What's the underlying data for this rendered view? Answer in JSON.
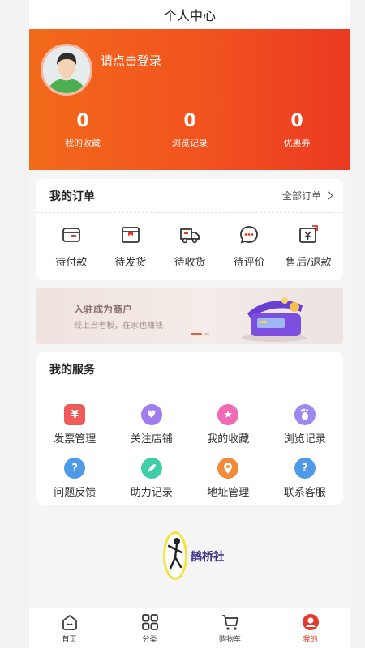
{
  "header": {
    "title": "个人中心"
  },
  "profile": {
    "login_prompt": "请点击登录",
    "stats": [
      {
        "value": "0",
        "label": "我的收藏"
      },
      {
        "value": "0",
        "label": "浏览记录"
      },
      {
        "value": "0",
        "label": "优惠券"
      }
    ]
  },
  "orders": {
    "title": "我的订单",
    "all_label": "全部订单",
    "items": [
      {
        "label": "待付款",
        "icon": "wallet-icon"
      },
      {
        "label": "待发货",
        "icon": "package-icon"
      },
      {
        "label": "待收货",
        "icon": "truck-icon"
      },
      {
        "label": "待评价",
        "icon": "comment-icon"
      },
      {
        "label": "售后/退款",
        "icon": "refund-icon"
      }
    ]
  },
  "banner": {
    "title": "入驻成为商户",
    "subtitle": "线上当老板，在家也赚钱"
  },
  "services": {
    "title": "我的服务",
    "items": [
      {
        "label": "发票管理",
        "icon": "invoice-icon",
        "color": "#ef5b5b"
      },
      {
        "label": "关注店铺",
        "icon": "heart-icon",
        "color": "#a07cf0"
      },
      {
        "label": "我的收藏",
        "icon": "star-icon",
        "color": "#f06bb4"
      },
      {
        "label": "浏览记录",
        "icon": "footprint-icon",
        "color": "#9d88f2"
      },
      {
        "label": "问题反馈",
        "icon": "question-icon",
        "color": "#4f9ae8"
      },
      {
        "label": "助力记录",
        "icon": "rocket-icon",
        "color": "#3fcfa6"
      },
      {
        "label": "地址管理",
        "icon": "location-icon",
        "color": "#f28a3a"
      },
      {
        "label": "联系客服",
        "icon": "help-icon",
        "color": "#4f9ae8"
      }
    ]
  },
  "brand": {
    "name": "鹊桥社"
  },
  "tabbar": {
    "items": [
      {
        "label": "首页",
        "icon": "home-icon"
      },
      {
        "label": "分类",
        "icon": "grid-icon"
      },
      {
        "label": "购物车",
        "icon": "cart-icon"
      },
      {
        "label": "我的",
        "icon": "user-icon"
      }
    ],
    "active_color": "#e23a2c"
  }
}
